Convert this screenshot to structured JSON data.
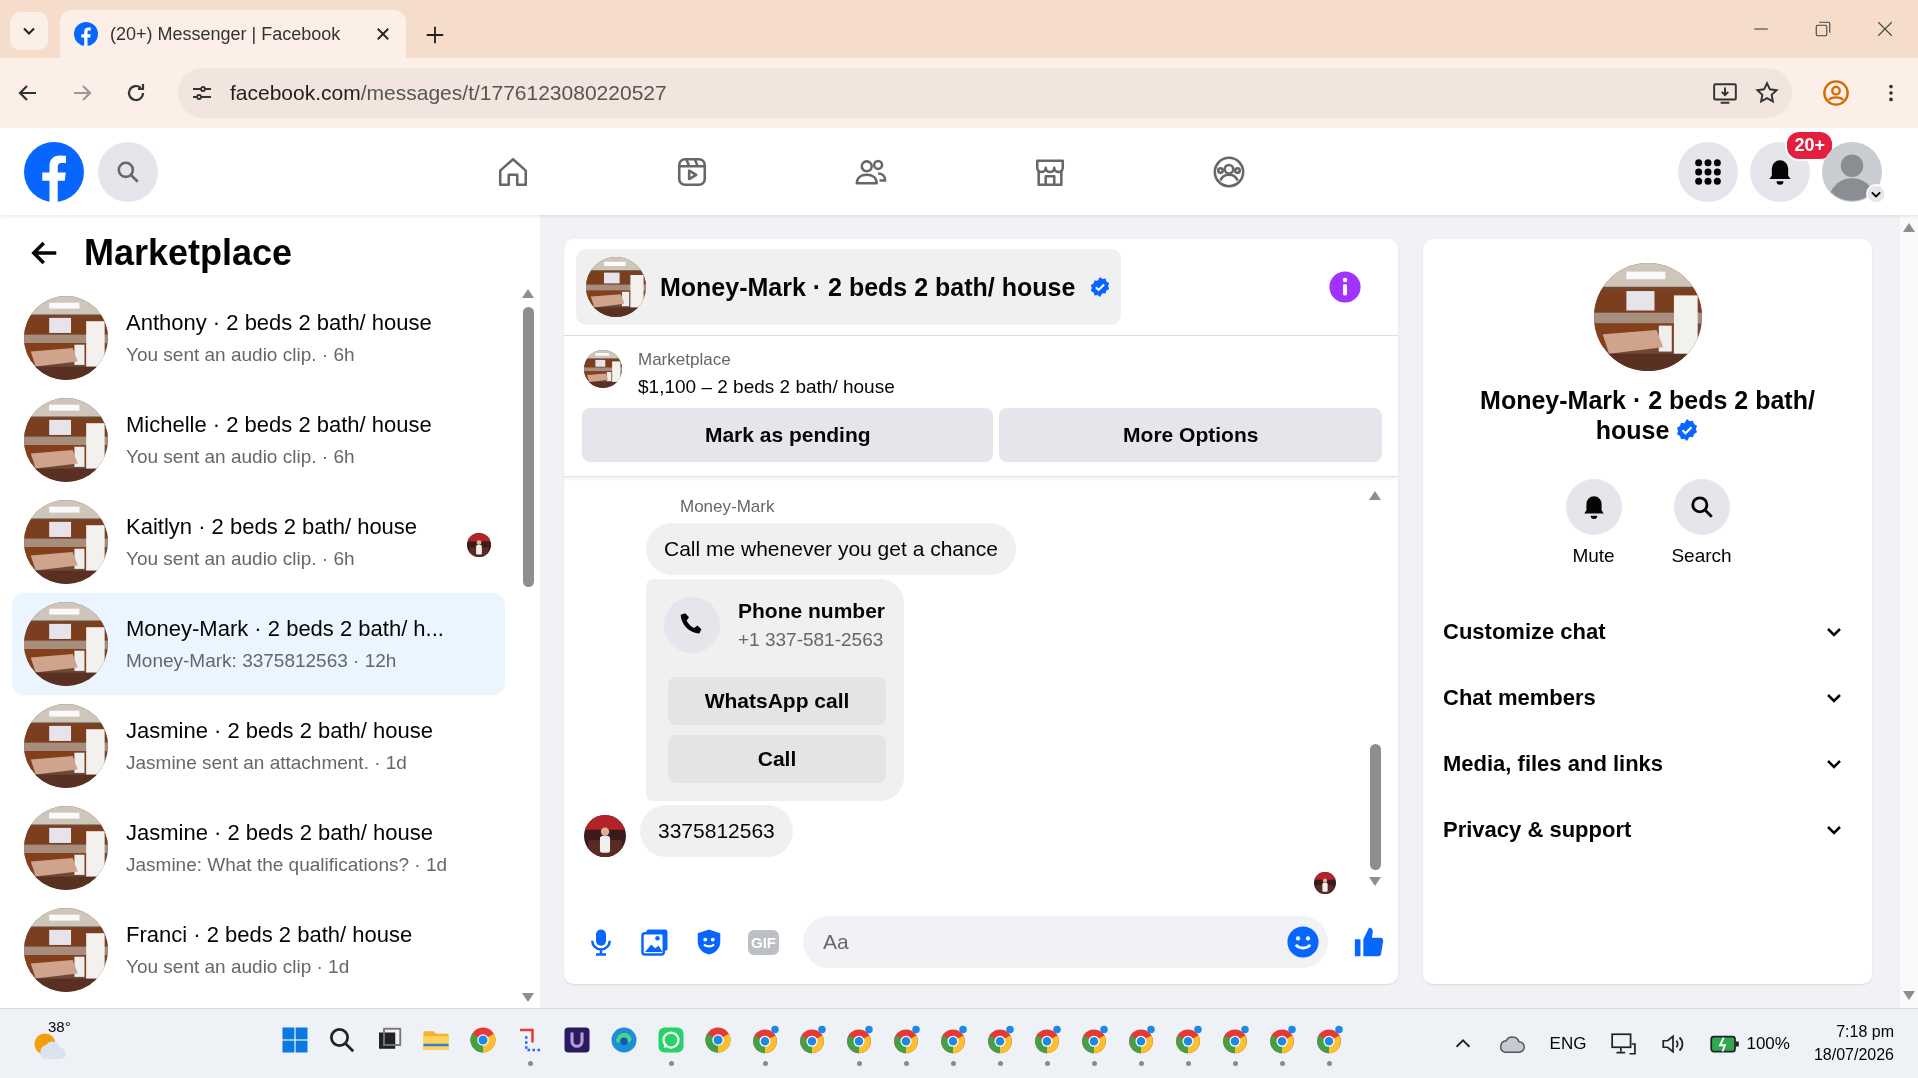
{
  "browser": {
    "tab": {
      "title": "(20+) Messenger | Facebook",
      "selected": true
    },
    "url_host": "facebook.com",
    "url_path": "/messages/t/1776123080220527"
  },
  "header": {
    "notification_count": "20+"
  },
  "sidebar": {
    "title": "Marketplace",
    "conversations": [
      {
        "name": "Anthony · 2 beds 2 bath/ house",
        "preview": "You sent an audio clip. · 6h",
        "selected": false,
        "seen": false
      },
      {
        "name": "Michelle · 2 beds 2 bath/ house",
        "preview": "You sent an audio clip. · 6h",
        "selected": false,
        "seen": false
      },
      {
        "name": "Kaitlyn · 2 beds 2 bath/ house",
        "preview": "You sent an audio clip. · 6h",
        "selected": false,
        "seen": true
      },
      {
        "name": "Money-Mark · 2 beds 2 bath/ h...",
        "preview": "Money-Mark: 3375812563 · 12h",
        "selected": true,
        "seen": false
      },
      {
        "name": "Jasmine · 2 beds 2 bath/ house",
        "preview": "Jasmine sent an attachment. · 1d",
        "selected": false,
        "seen": false
      },
      {
        "name": "Jasmine · 2 beds 2 bath/ house",
        "preview": "Jasmine: What the qualifications? · 1d",
        "selected": false,
        "seen": false
      },
      {
        "name": "Franci · 2 beds 2 bath/ house",
        "preview": "You sent an audio clip · 1d",
        "selected": false,
        "seen": false
      }
    ]
  },
  "chat": {
    "title": "Money-Mark · 2 beds 2 bath/ house",
    "verified": true,
    "listing": {
      "label": "Marketplace",
      "title": "$1,100 – 2 beds 2 bath/ house",
      "buttons": [
        "Mark as pending",
        "More Options"
      ]
    },
    "sender": "Money-Mark",
    "messages": [
      {
        "kind": "text",
        "text": "Call me whenever you get a chance",
        "avatar": false
      },
      {
        "kind": "contact",
        "title": "Phone number",
        "number": "+1 337-581-2563",
        "actions": [
          "WhatsApp call",
          "Call"
        ],
        "avatar": false
      },
      {
        "kind": "text",
        "text": "3375812563",
        "avatar": true
      }
    ],
    "seen": true,
    "composer": {
      "gif_label": "GIF",
      "placeholder": "Aa"
    }
  },
  "details": {
    "name": "Money-Mark · 2 beds 2 bath/ house",
    "verified": true,
    "actions": [
      {
        "kind": "mute",
        "label": "Mute"
      },
      {
        "kind": "search",
        "label": "Search"
      }
    ],
    "sections": [
      {
        "label": "Customize chat",
        "expanded": false
      },
      {
        "label": "Chat members",
        "expanded": false
      },
      {
        "label": "Media, files and links",
        "expanded": false
      },
      {
        "label": "Privacy & support",
        "expanded": false
      }
    ]
  },
  "taskbar": {
    "weather": "38°",
    "apps": [
      {
        "kind": "windows",
        "open": false
      },
      {
        "kind": "search",
        "open": false
      },
      {
        "kind": "task-view",
        "open": false
      },
      {
        "kind": "folder",
        "open": false
      },
      {
        "kind": "chrome",
        "open": false
      },
      {
        "kind": "snipping",
        "open": true
      },
      {
        "kind": "shield-app",
        "open": false
      },
      {
        "kind": "edge",
        "open": false
      },
      {
        "kind": "whatsapp",
        "open": true
      },
      {
        "kind": "chrome",
        "open": false
      },
      {
        "kind": "chrome-profile",
        "open": true
      },
      {
        "kind": "chrome-profile",
        "open": false
      },
      {
        "kind": "chrome-profile",
        "open": true
      },
      {
        "kind": "chrome-profile",
        "open": true
      },
      {
        "kind": "chrome-profile",
        "open": true
      },
      {
        "kind": "chrome-profile",
        "open": true
      },
      {
        "kind": "chrome-profile",
        "open": true
      },
      {
        "kind": "chrome-profile",
        "open": true
      },
      {
        "kind": "chrome-profile",
        "open": true
      },
      {
        "kind": "chrome-profile",
        "open": true
      },
      {
        "kind": "chrome-profile",
        "open": true
      },
      {
        "kind": "chrome-profile",
        "open": true
      },
      {
        "kind": "chrome-profile",
        "open": true
      }
    ],
    "language": "ENG",
    "battery": "100%",
    "time": "7:18 pm",
    "date": "18/07/2026"
  }
}
